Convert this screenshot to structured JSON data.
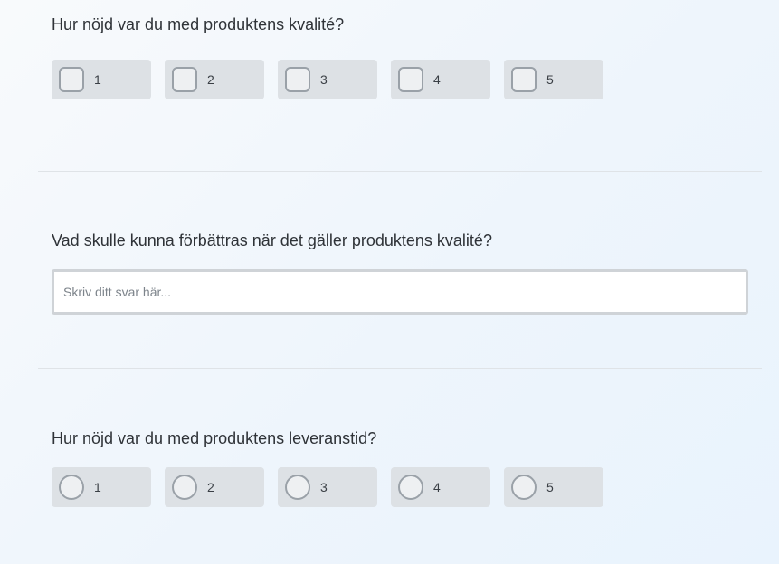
{
  "questions": {
    "quality_rating": {
      "title": "Hur nöjd var du med produktens kvalité?",
      "control": "checkbox",
      "options": [
        "1",
        "2",
        "3",
        "4",
        "5"
      ]
    },
    "quality_improvement": {
      "title": "Vad skulle kunna förbättras när det gäller produktens kvalité?",
      "placeholder": "Skriv ditt svar här...",
      "value": ""
    },
    "delivery_rating": {
      "title": "Hur nöjd var du med produktens leveranstid?",
      "control": "radio",
      "options": [
        "1",
        "2",
        "3",
        "4",
        "5"
      ]
    }
  },
  "colors": {
    "option_background": "#dde1e5",
    "control_border": "#9aa1a8",
    "divider": "#dfe3e7"
  }
}
